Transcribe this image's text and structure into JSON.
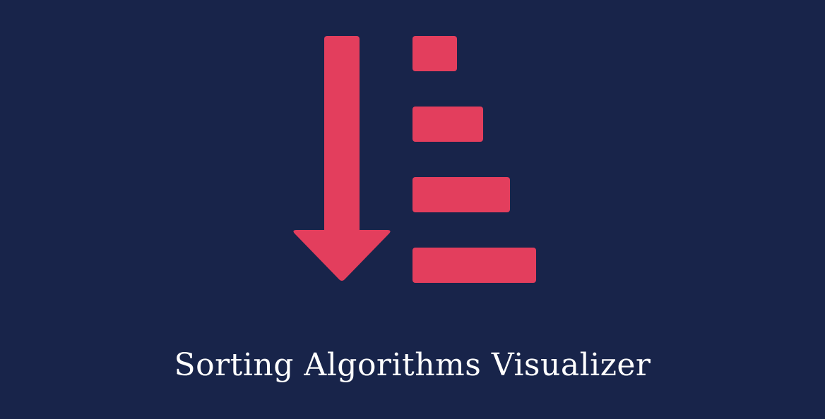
{
  "title": "Sorting Algorithms Visualizer",
  "colors": {
    "background": "#18244a",
    "accent": "#e33e5d",
    "text": "#ffffff"
  },
  "icons": {
    "sort_arrow": "arrow-down-icon",
    "sort_bars": "sort-ascending-bars-icon"
  }
}
